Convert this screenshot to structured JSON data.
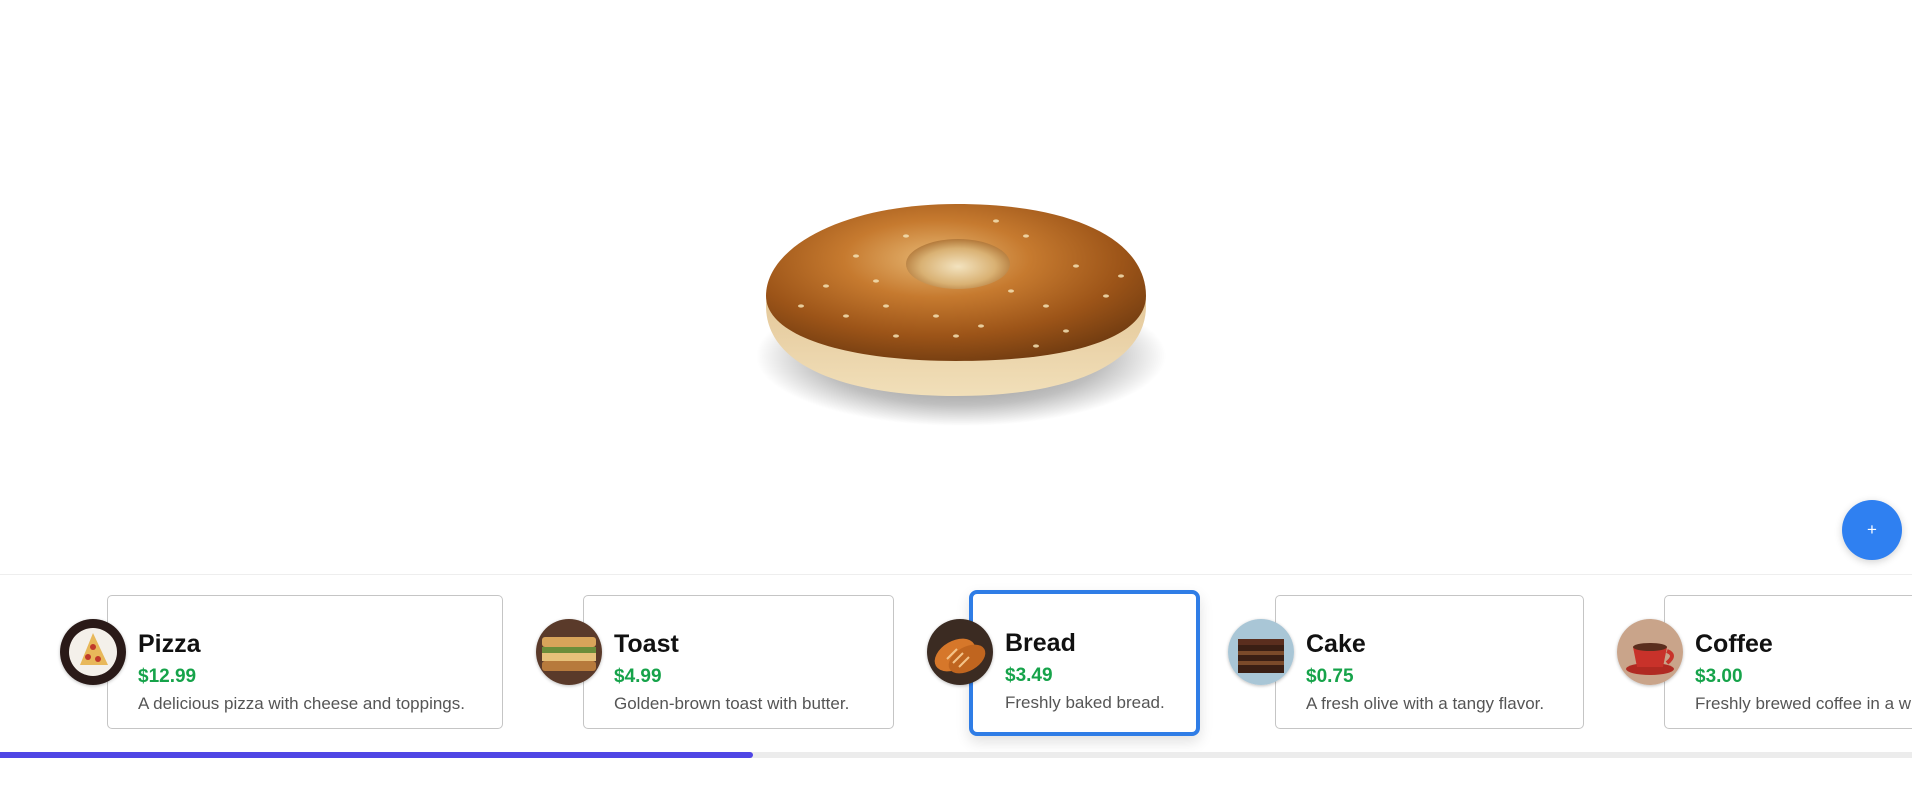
{
  "hero": {
    "icon": "bagel-image"
  },
  "fab": {
    "label": "+"
  },
  "menu": {
    "selected_index": 2,
    "items": [
      {
        "name": "Pizza",
        "price": "$12.99",
        "description": "A delicious pizza with cheese and toppings.",
        "icon": "pizza-icon"
      },
      {
        "name": "Toast",
        "price": "$4.99",
        "description": "Golden-brown toast with butter.",
        "icon": "toast-icon"
      },
      {
        "name": "Bread",
        "price": "$3.49",
        "description": "Freshly baked bread.",
        "icon": "bread-icon"
      },
      {
        "name": "Cake",
        "price": "$0.75",
        "description": "A fresh olive with a tangy flavor.",
        "icon": "cake-icon"
      },
      {
        "name": "Coffee",
        "price": "$3.00",
        "description": "Freshly brewed coffee in a w",
        "icon": "coffee-icon"
      }
    ]
  },
  "progress": {
    "value": 0.394
  },
  "colors": {
    "accent": "#2f80f1",
    "selected_border": "#2f7de6",
    "price": "#16a34a",
    "progress": "#4f46e5"
  }
}
